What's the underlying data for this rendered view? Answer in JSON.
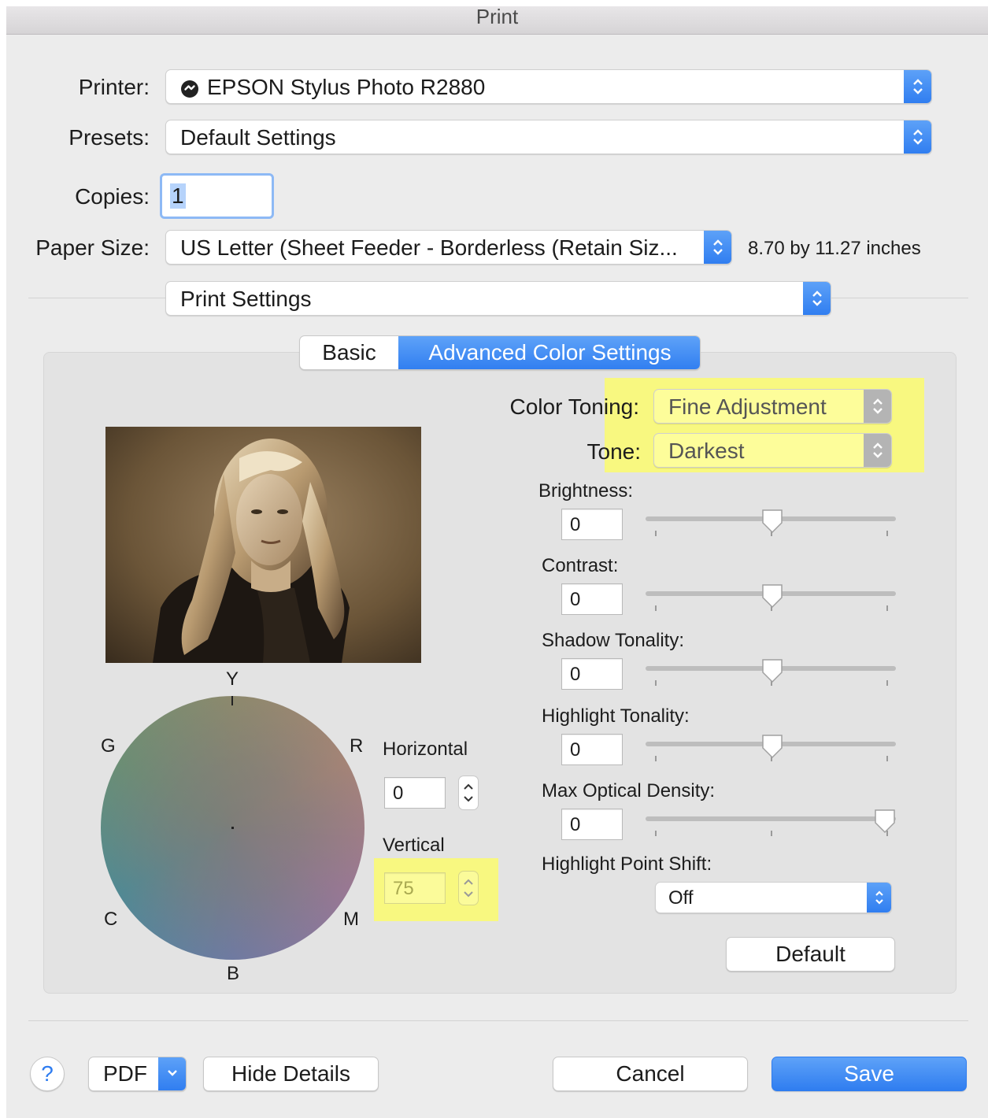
{
  "window": {
    "title": "Print"
  },
  "printer": {
    "label": "Printer:",
    "value": "EPSON Stylus Photo R2880",
    "icon": "printer-status-icon"
  },
  "presets": {
    "label": "Presets:",
    "value": "Default Settings"
  },
  "copies": {
    "label": "Copies:",
    "value": "1"
  },
  "paper": {
    "label": "Paper Size:",
    "value": "US Letter (Sheet Feeder - Borderless (Retain Siz...",
    "dimensions": "8.70 by 11.27 inches"
  },
  "section": {
    "value": "Print Settings"
  },
  "tabs": [
    {
      "label": "Basic",
      "selected": false
    },
    {
      "label": "Advanced Color Settings",
      "selected": true
    }
  ],
  "color_toning": {
    "label": "Color Toning:",
    "value": "Fine Adjustment"
  },
  "tone": {
    "label": "Tone:",
    "value": "Darkest"
  },
  "sliders": [
    {
      "label": "Brightness:",
      "value": "0",
      "position": 0.5
    },
    {
      "label": "Contrast:",
      "value": "0",
      "position": 0.5
    },
    {
      "label": "Shadow Tonality:",
      "value": "0",
      "position": 0.5
    },
    {
      "label": "Highlight Tonality:",
      "value": "0",
      "position": 0.5
    },
    {
      "label": "Max Optical Density:",
      "value": "0",
      "position": 1.0
    }
  ],
  "highlight_point_shift": {
    "label": "Highlight Point Shift:",
    "value": "Off"
  },
  "default_button": "Default",
  "wheel": {
    "letters": {
      "y": "Y",
      "r": "R",
      "m": "M",
      "b": "B",
      "c": "C",
      "g": "G"
    },
    "horizontal": {
      "label": "Horizontal",
      "value": "0"
    },
    "vertical": {
      "label": "Vertical",
      "value": "75"
    }
  },
  "footer": {
    "help": "?",
    "pdf": "PDF",
    "hide_details": "Hide Details",
    "cancel": "Cancel",
    "save": "Save"
  },
  "colors": {
    "accent": "#3a86f4",
    "highlight": "#fbfb6e",
    "window_bg": "#ececec",
    "panel_bg": "#e3e3e3"
  }
}
